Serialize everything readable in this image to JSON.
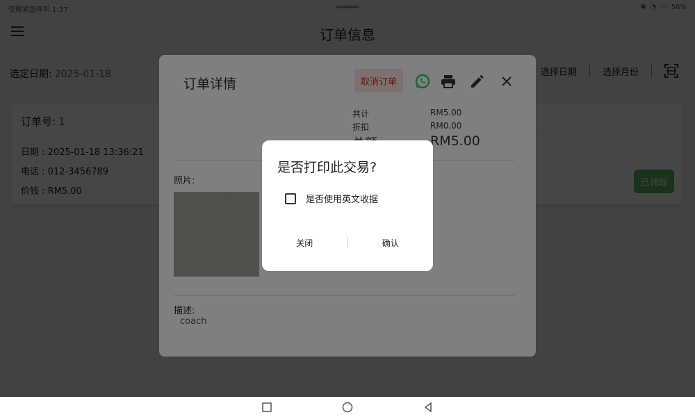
{
  "status_bar": {
    "left_text": "仅限紧急呼叫 1:37",
    "battery": "56%"
  },
  "app_bar": {
    "title": "订单信息"
  },
  "date_row": {
    "label": "选定日期:",
    "value": "2025-01-18"
  },
  "top_actions": {
    "select_date": "选择日期",
    "select_month": "选择月份"
  },
  "order_card": {
    "order_no_label": "订单号:",
    "order_no_value": "1",
    "date": "日期 : 2025-01-18 13:36:21",
    "phone": "电话 : 012-3456789",
    "price": "价钱 : RM5.00",
    "claimed_button": "已领取"
  },
  "detail_dialog": {
    "title": "订单详情",
    "cancel_button": "取消订单",
    "summary": {
      "total_label": "共计",
      "total_value": "RM5.00",
      "discount_label": "折扣",
      "discount_value": "RM0.00",
      "amount_label": "总额",
      "amount_value": "RM5.00"
    },
    "photo_label": "照片:",
    "desc_label": "描述:",
    "desc_value": "coach"
  },
  "confirm_dialog": {
    "title": "是否打印此交易?",
    "checkbox_label": "是否使用英文收据",
    "close_button": "关闭",
    "confirm_button": "确认"
  },
  "colors": {
    "cancel_bg": "#fbe1e1",
    "cancel_text": "#d0312d",
    "whatsapp": "#25d366",
    "claimed_bg": "#5cb85c"
  }
}
